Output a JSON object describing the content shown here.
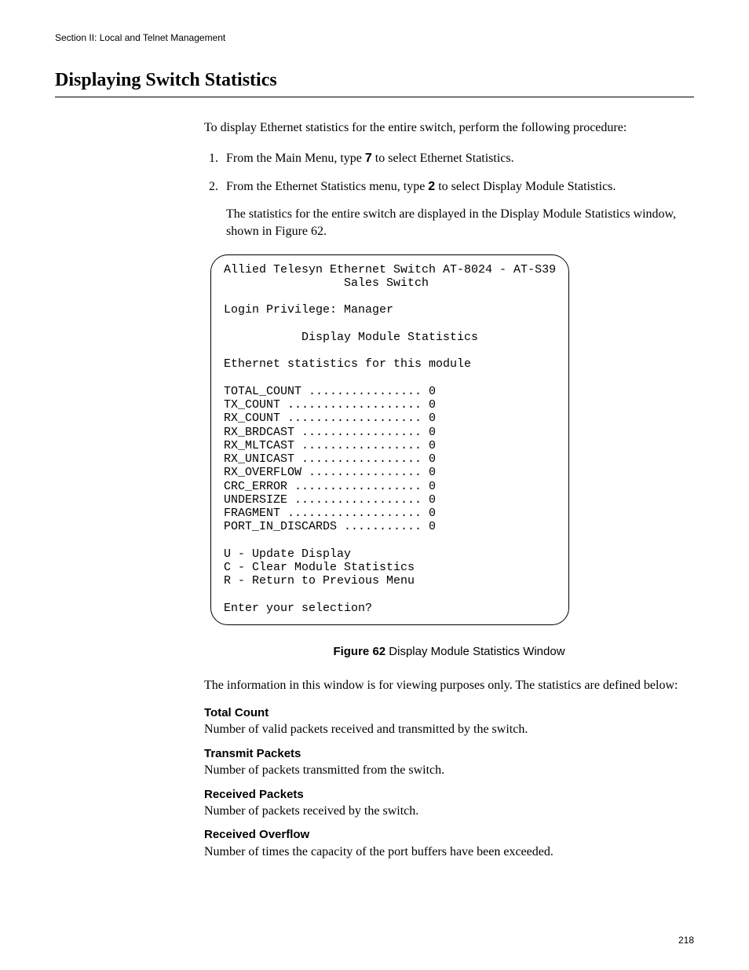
{
  "section_header": "Section II: Local and Telnet Management",
  "title": "Displaying Switch Statistics",
  "intro": "To display Ethernet statistics for the entire switch, perform the following procedure:",
  "steps": [
    {
      "prefix": "From the Main Menu, type ",
      "bold": "7",
      "suffix": " to select Ethernet Statistics."
    },
    {
      "prefix": "From the Ethernet Statistics menu, type ",
      "bold": "2",
      "suffix": " to select Display Module Statistics."
    }
  ],
  "after_steps": "The statistics for the entire switch are displayed in the Display Module Statistics window, shown in Figure 62.",
  "terminal": {
    "line1": "Allied Telesyn Ethernet Switch AT-8024 - AT-S39",
    "line2_centered": "Sales Switch",
    "login": "Login Privilege: Manager",
    "screen_title_centered": "Display Module Statistics",
    "subtitle": "Ethernet statistics for this module",
    "stats": [
      {
        "label": "TOTAL_COUNT",
        "value": "0"
      },
      {
        "label": "TX_COUNT",
        "value": "0"
      },
      {
        "label": "RX_COUNT",
        "value": "0"
      },
      {
        "label": "RX_BRDCAST",
        "value": "0"
      },
      {
        "label": "RX_MLTCAST",
        "value": "0"
      },
      {
        "label": "RX_UNICAST",
        "value": "0"
      },
      {
        "label": "RX_OVERFLOW",
        "value": "0"
      },
      {
        "label": "CRC_ERROR",
        "value": "0"
      },
      {
        "label": "UNDERSIZE",
        "value": "0"
      },
      {
        "label": "FRAGMENT",
        "value": "0"
      },
      {
        "label": "PORT_IN_DISCARDS",
        "value": "0"
      }
    ],
    "menu": [
      "U - Update Display",
      "C - Clear Module Statistics",
      "R - Return to Previous Menu"
    ],
    "prompt": "Enter your selection?"
  },
  "figure": {
    "label": "Figure 62",
    "caption": "  Display Module Statistics Window"
  },
  "after_figure": "The information in this window is for viewing purposes only. The statistics are defined below:",
  "definitions": [
    {
      "term": "Total Count",
      "desc": "Number of valid packets received and transmitted by the switch."
    },
    {
      "term": "Transmit Packets",
      "desc": "Number of packets transmitted from the switch."
    },
    {
      "term": "Received Packets",
      "desc": "Number of packets received by the switch."
    },
    {
      "term": "Received Overflow",
      "desc": "Number of times the capacity of the port buffers have been exceeded."
    }
  ],
  "page_number": "218"
}
